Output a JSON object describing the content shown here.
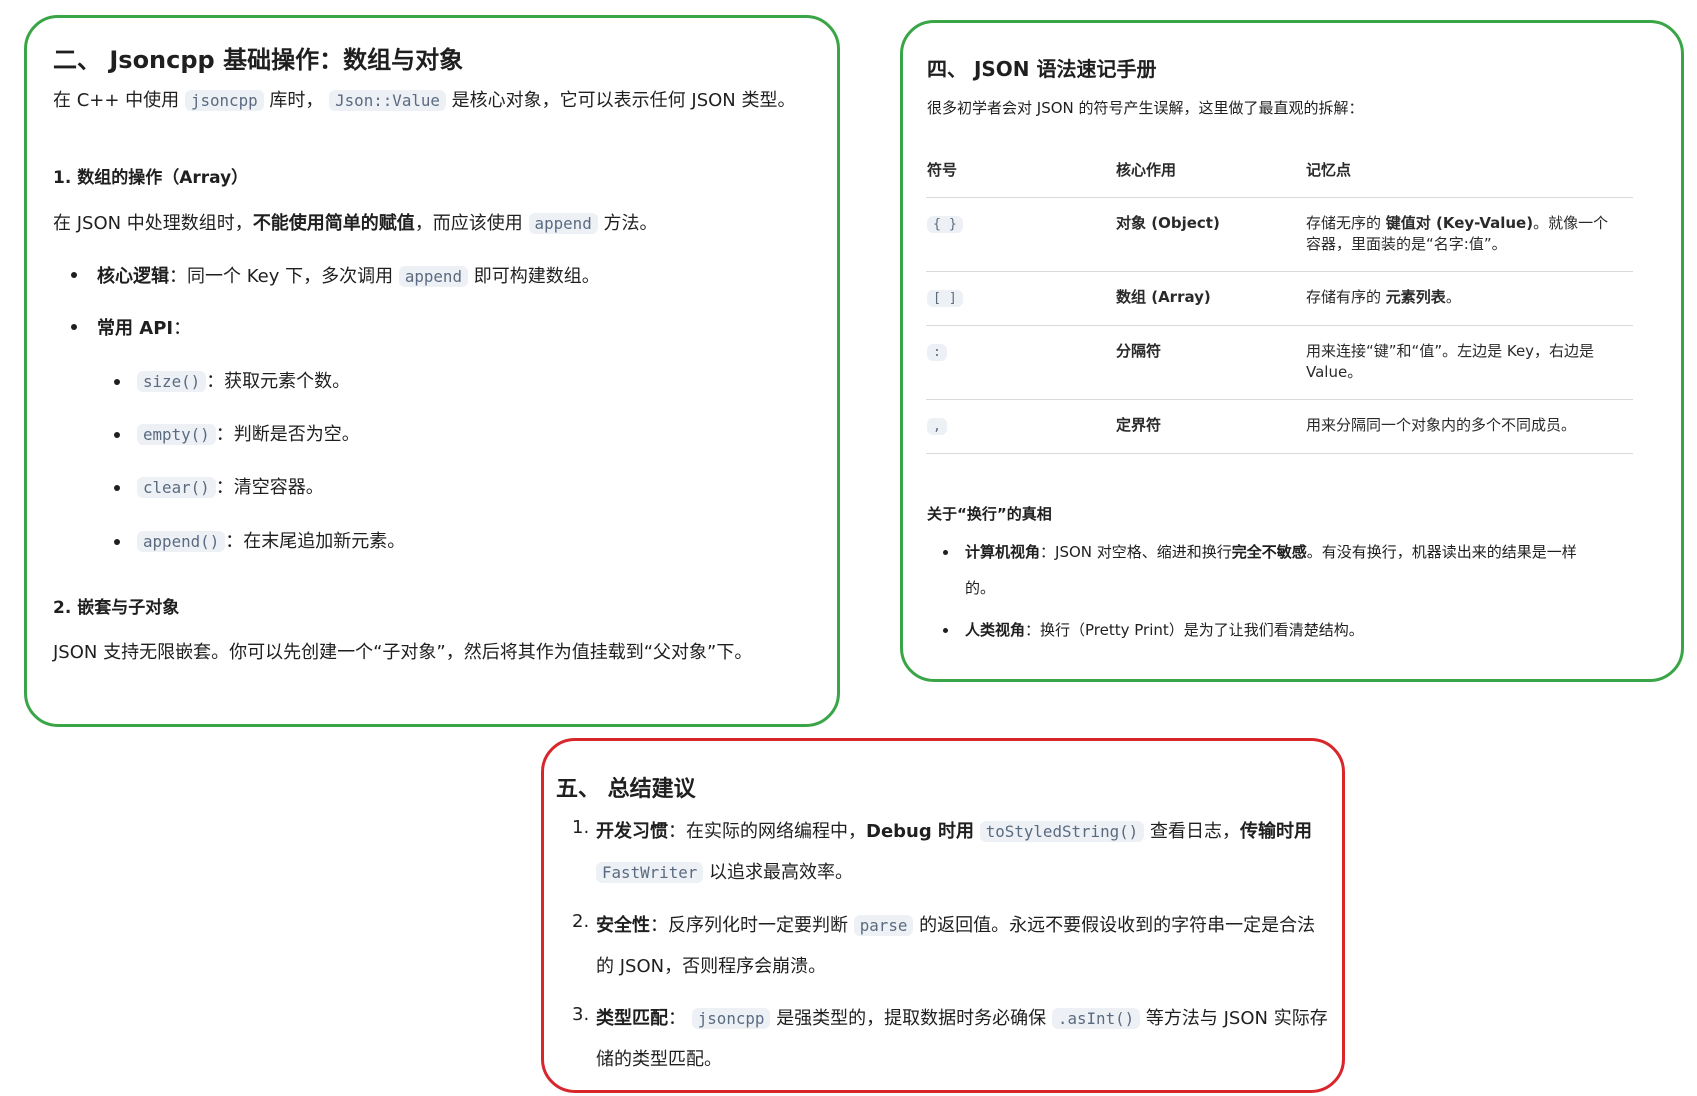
{
  "section2": {
    "title": "二、 Jsoncpp 基础操作：数组与对象",
    "intro": {
      "p1": "在 C++ 中使用",
      "c1": "jsoncpp",
      "p2": "库时，",
      "c2": "Json::Value",
      "p3": "是核心对象，它可以表示任何 JSON 类型。"
    },
    "sub1_title": "1. 数组的操作（Array）",
    "sub1_text": {
      "p1": "在 JSON 中处理数组时，",
      "b1": "不能使用简单的赋值",
      "p2": "，而应该使用",
      "c1": "append",
      "p3": "方法。"
    },
    "bullet1": {
      "b": "核心逻辑",
      "p1": "：同一个 Key 下，多次调用",
      "c": "append",
      "p2": "即可构建数组。"
    },
    "bullet2": {
      "b": "常用 API",
      "p": "："
    },
    "api": [
      {
        "code": "size()",
        "text": "：获取元素个数。"
      },
      {
        "code": "empty()",
        "text": "：判断是否为空。"
      },
      {
        "code": "clear()",
        "text": "：清空容器。"
      },
      {
        "code": "append()",
        "text": "：在末尾追加新元素。"
      }
    ],
    "sub2_title": "2. 嵌套与子对象",
    "sub2_text": "JSON 支持无限嵌套。你可以先创建一个“子对象”，然后将其作为值挂载到“父对象”下。"
  },
  "section4": {
    "title": "四、 JSON 语法速记手册",
    "intro": "很多初学者会对 JSON 的符号产生误解，这里做了最直观的拆解：",
    "headers": [
      "符号",
      "核心作用",
      "记忆点"
    ],
    "rows": [
      {
        "symbol": "{ }",
        "role": "对象 (Object)",
        "memo_p1": "存储无序的",
        "memo_b": "键值对 (Key-Value)",
        "memo_p2": "。就像一个",
        "memo_p3": "容器，里面装的是“名字:值”。"
      },
      {
        "symbol": "[ ]",
        "role": "数组 (Array)",
        "memo_p1": "存储有序的",
        "memo_b": "元素列表",
        "memo_p2": "。"
      },
      {
        "symbol": ":",
        "role": "分隔符",
        "memo_p1": "用来连接“键”和“值”。左边是 Key，右边是",
        "memo_p3": "Value。"
      },
      {
        "symbol": ",",
        "role": "定界符",
        "memo_p1": "用来分隔同一个对象内的多个不同成员。"
      }
    ],
    "sub_title": "关于“换行”的真相",
    "b1": {
      "b": "计算机视角",
      "p1": "：JSON 对空格、缩进和换行",
      "b2": "完全不敏感",
      "p2": "。有没有换行，机器读出来的结果是一样",
      "p3": "的。"
    },
    "b2": {
      "b": "人类视角",
      "p": "：换行（Pretty Print）是为了让我们看清楚结构。"
    }
  },
  "section5": {
    "title": "五、 总结建议",
    "items": [
      {
        "num": "1.",
        "b1": "开发习惯",
        "p1": "：在实际的网络编程中，",
        "b2": "Debug 时用",
        "c1": "toStyledString()",
        "p2": "查看日志，",
        "b3": "传输时用",
        "c2": "FastWriter",
        "p3": "以追求最高效率。"
      },
      {
        "num": "2.",
        "b1": "安全性",
        "p1": "：反序列化时一定要判断",
        "c1": "parse",
        "p2": "的返回值。永远不要假设收到的字符串一定是合法",
        "p3": "的 JSON，否则程序会崩溃。"
      },
      {
        "num": "3.",
        "b1": "类型匹配",
        "p1": "：",
        "c1": "jsoncpp",
        "p2": "是强类型的，提取数据时务必确保",
        "c2": ".asInt()",
        "p3": "等方法与 JSON 实际存",
        "p4": "储的类型匹配。"
      }
    ]
  }
}
